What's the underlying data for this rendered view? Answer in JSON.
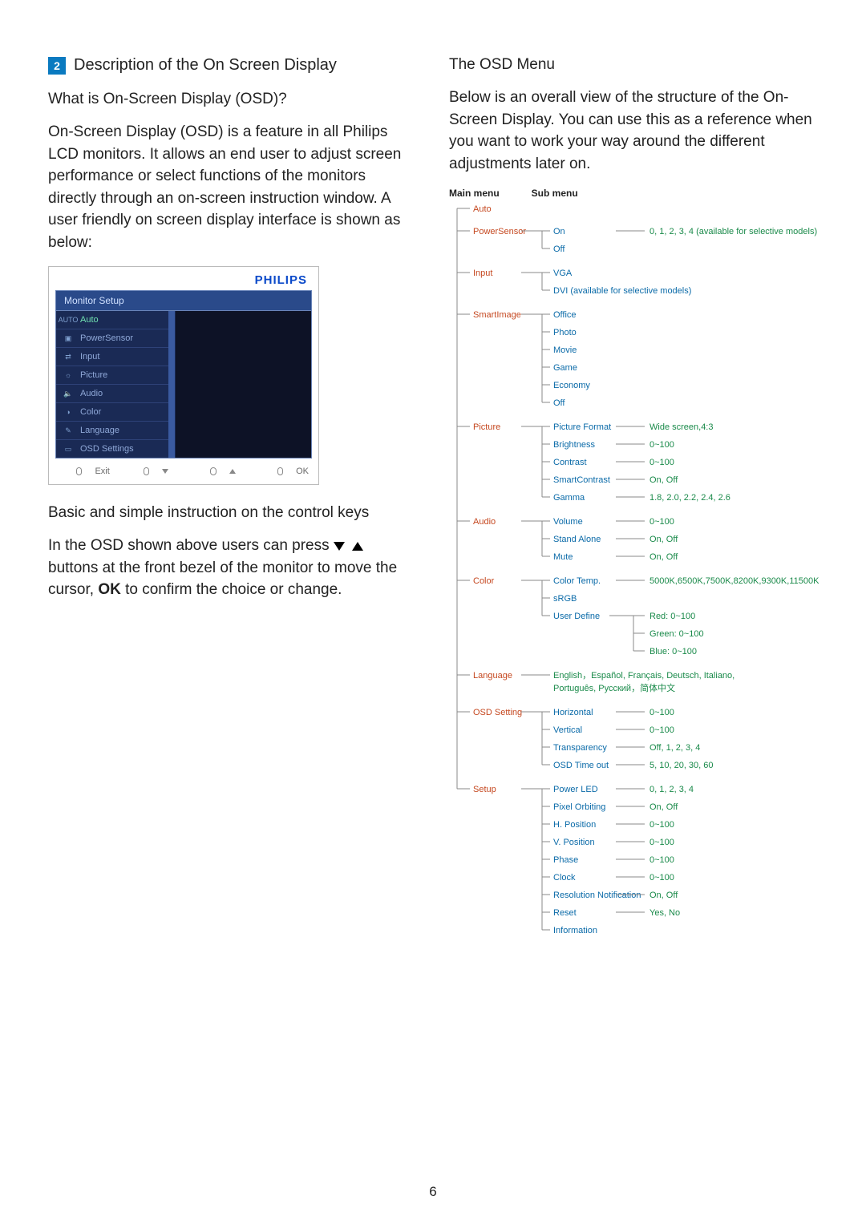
{
  "section_number": "2",
  "section_title": "Description of the On Screen Display",
  "left": {
    "q_title": "What is On-Screen Display (OSD)?",
    "p1": "On-Screen Display (OSD) is a feature in all Philips LCD monitors. It allows an end user to adjust screen performance or select functions of the monitors directly through an on-screen instruction window. A user friendly on screen display interface is shown as below:",
    "basic_title": "Basic and simple instruction on the control keys",
    "p2a": "In the OSD shown above users can press ",
    "p2b": " buttons at the front bezel of the monitor to move the cursor, ",
    "ok": "OK",
    "p2c": " to confirm the choice or change."
  },
  "osd": {
    "brand": "PHILIPS",
    "title": "Monitor Setup",
    "items": [
      "Auto",
      "PowerSensor",
      "Input",
      "Picture",
      "Audio",
      "Color",
      "Language",
      "OSD Settings"
    ],
    "icons": [
      "AUTO",
      "▣",
      "⇄",
      "☼",
      "🔈",
      "◑",
      "✎",
      "▭"
    ],
    "foot_exit": "Exit",
    "foot_ok": "OK"
  },
  "right": {
    "title": "The OSD Menu",
    "p": "Below is an overall view of the structure of the On-Screen Display. You can use this as a reference when you want to work your way around the different adjustments later on.",
    "head_main": "Main menu",
    "head_sub": "Sub menu"
  },
  "tree": [
    {
      "name": "Auto",
      "children": []
    },
    {
      "name": "PowerSensor",
      "children": [
        {
          "name": "On",
          "val": "0, 1, 2, 3, 4 (available for selective models)"
        },
        {
          "name": "Off"
        }
      ]
    },
    {
      "name": "Input",
      "children": [
        {
          "name": "VGA"
        },
        {
          "name": "DVI (available for selective models)"
        }
      ]
    },
    {
      "name": "SmartImage",
      "children": [
        {
          "name": "Office"
        },
        {
          "name": "Photo"
        },
        {
          "name": "Movie"
        },
        {
          "name": "Game"
        },
        {
          "name": "Economy"
        },
        {
          "name": "Off"
        }
      ]
    },
    {
      "name": "Picture",
      "children": [
        {
          "name": "Picture Format",
          "val": "Wide screen,4:3"
        },
        {
          "name": "Brightness",
          "val": "0~100"
        },
        {
          "name": "Contrast",
          "val": "0~100"
        },
        {
          "name": "SmartContrast",
          "val": "On, Off"
        },
        {
          "name": "Gamma",
          "val": "1.8, 2.0, 2.2, 2.4, 2.6"
        }
      ]
    },
    {
      "name": "Audio",
      "children": [
        {
          "name": "Volume",
          "val": "0~100"
        },
        {
          "name": "Stand Alone",
          "val": "On, Off"
        },
        {
          "name": "Mute",
          "val": "On, Off"
        }
      ]
    },
    {
      "name": "Color",
      "children": [
        {
          "name": "Color Temp.",
          "val": "5000K,6500K,7500K,8200K,9300K,11500K"
        },
        {
          "name": "sRGB"
        },
        {
          "name": "User Define",
          "children": [
            {
              "name": "Red: 0~100"
            },
            {
              "name": "Green: 0~100"
            },
            {
              "name": "Blue: 0~100"
            }
          ]
        }
      ]
    },
    {
      "name": "Language",
      "line": "English，Español, Français, Deutsch, Italiano, Português, Русский，简体中文"
    },
    {
      "name": "OSD Setting",
      "children": [
        {
          "name": "Horizontal",
          "val": "0~100"
        },
        {
          "name": "Vertical",
          "val": "0~100"
        },
        {
          "name": "Transparency",
          "val": "Off, 1, 2, 3, 4"
        },
        {
          "name": "OSD Time out",
          "val": "5, 10, 20, 30, 60"
        }
      ]
    },
    {
      "name": "Setup",
      "children": [
        {
          "name": "Power LED",
          "val": "0, 1, 2, 3, 4"
        },
        {
          "name": "Pixel Orbiting",
          "val": "On, Off"
        },
        {
          "name": "H. Position",
          "val": "0~100"
        },
        {
          "name": "V. Position",
          "val": "0~100"
        },
        {
          "name": "Phase",
          "val": "0~100"
        },
        {
          "name": "Clock",
          "val": "0~100"
        },
        {
          "name": "Resolution Notification",
          "val": "On, Off"
        },
        {
          "name": "Reset",
          "val": "Yes, No"
        },
        {
          "name": "Information"
        }
      ]
    }
  ],
  "page_number": "6"
}
